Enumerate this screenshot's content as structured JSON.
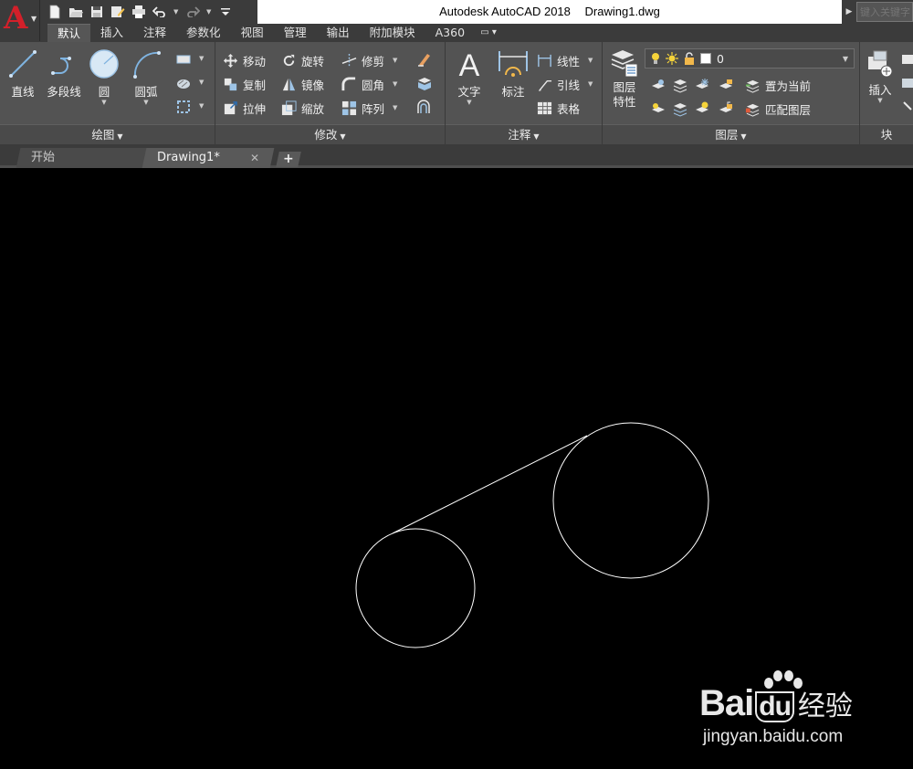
{
  "window": {
    "app_name": "Autodesk AutoCAD 2018",
    "file_name": "Drawing1.dwg"
  },
  "app_button": {
    "logo": "A"
  },
  "quick_access": [
    {
      "icon": "new-icon"
    },
    {
      "icon": "open-icon"
    },
    {
      "icon": "save-icon"
    },
    {
      "icon": "save-as-icon"
    },
    {
      "icon": "plot-icon"
    },
    {
      "icon": "undo-icon"
    },
    {
      "icon": "redo-icon"
    },
    {
      "icon": "customize-icon"
    }
  ],
  "search": {
    "placeholder": "键入关键字"
  },
  "ribbon_tabs": [
    "默认",
    "插入",
    "注释",
    "参数化",
    "视图",
    "管理",
    "输出",
    "附加模块",
    "A360"
  ],
  "active_tab": "默认",
  "panels": {
    "draw": {
      "title": "绘图",
      "line": "直线",
      "polyline": "多段线",
      "circle": "圆",
      "arc": "圆弧"
    },
    "modify": {
      "title": "修改",
      "move": "移动",
      "rotate": "旋转",
      "trim": "修剪",
      "copy": "复制",
      "mirror": "镜像",
      "fillet": "圆角",
      "stretch": "拉伸",
      "scale": "缩放",
      "array": "阵列"
    },
    "annotation": {
      "title": "注释",
      "text": "文字",
      "dimension": "标注",
      "linear": "线性",
      "leader": "引线",
      "table": "表格"
    },
    "layers": {
      "title": "图层",
      "properties_line1": "图层",
      "properties_line2": "特性",
      "current_layer": "0",
      "make_current": "置为当前",
      "match_layer": "匹配图层"
    },
    "block": {
      "title": "块",
      "insert": "插入"
    }
  },
  "file_tabs": {
    "start": "开始",
    "drawing": "Drawing1*",
    "add": "+"
  },
  "watermark": {
    "brand_latin": "Bai",
    "brand_du": "du",
    "brand_cn": "经验",
    "url": "jingyan.baidu.com"
  },
  "colors": {
    "title_bar": "#ffffff",
    "ribbon": "#535353",
    "canvas": "#000000",
    "geometry": "#ffffff",
    "logo_red": "#d3202a"
  }
}
